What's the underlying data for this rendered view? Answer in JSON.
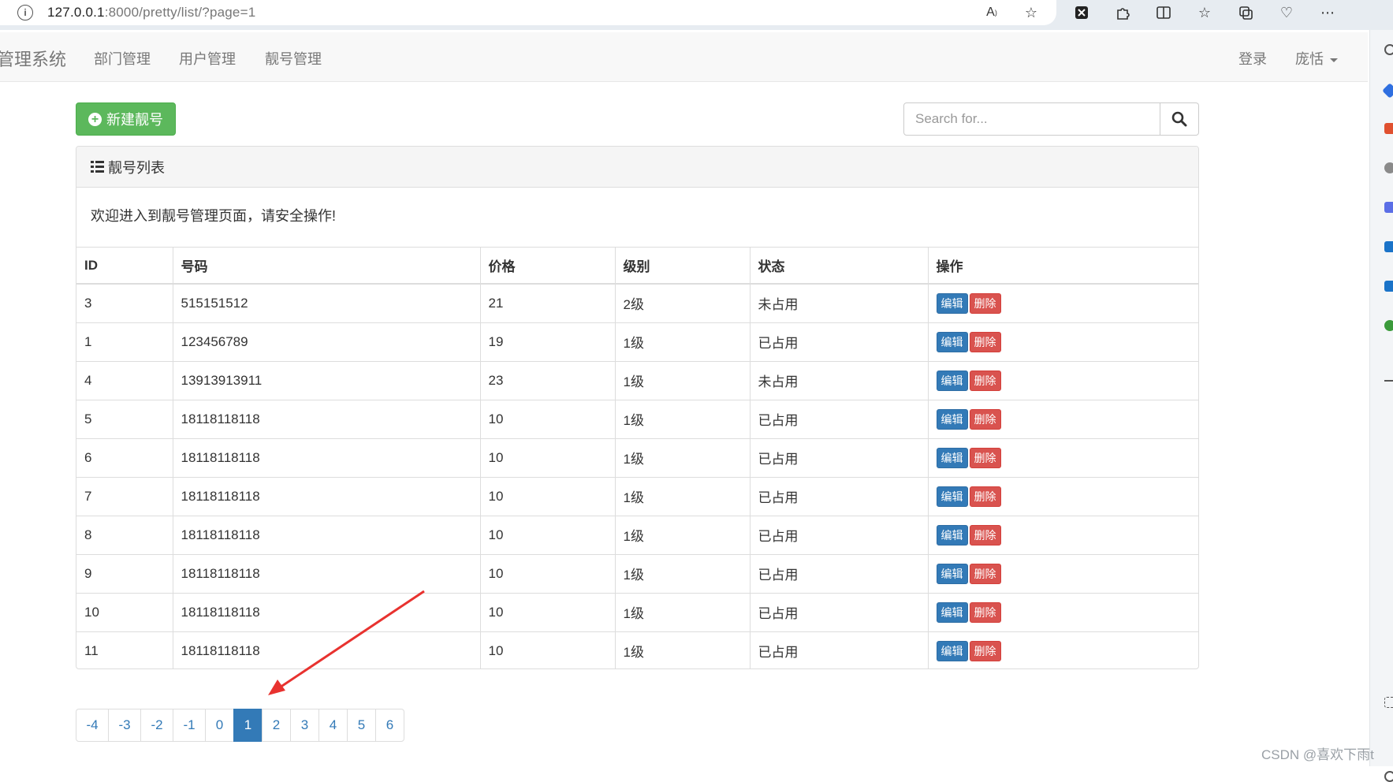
{
  "browser": {
    "url_host": "127.0.0.1",
    "url_rest": ":8000/pretty/list/?page=1"
  },
  "navbar": {
    "brand": "管理系统",
    "links": [
      "部门管理",
      "用户管理",
      "靓号管理"
    ],
    "login": "登录",
    "user": "庞恬"
  },
  "toolbar": {
    "new_button": "新建靓号",
    "search_placeholder": "Search for..."
  },
  "panel": {
    "title": "靓号列表",
    "welcome": "欢迎进入到靓号管理页面，请安全操作!"
  },
  "table": {
    "columns": [
      "ID",
      "号码",
      "价格",
      "级别",
      "状态",
      "操作"
    ],
    "edit_label": "编辑",
    "delete_label": "删除",
    "rows": [
      [
        "3",
        "515151512",
        "21",
        "2级",
        "未占用"
      ],
      [
        "1",
        "123456789",
        "19",
        "1级",
        "已占用"
      ],
      [
        "4",
        "13913913911",
        "23",
        "1级",
        "未占用"
      ],
      [
        "5",
        "18118118118",
        "10",
        "1级",
        "已占用"
      ],
      [
        "6",
        "18118118118",
        "10",
        "1级",
        "已占用"
      ],
      [
        "7",
        "18118118118",
        "10",
        "1级",
        "已占用"
      ],
      [
        "8",
        "18118118118",
        "10",
        "1级",
        "已占用"
      ],
      [
        "9",
        "18118118118",
        "10",
        "1级",
        "已占用"
      ],
      [
        "10",
        "18118118118",
        "10",
        "1级",
        "已占用"
      ],
      [
        "11",
        "18118118118",
        "10",
        "1级",
        "已占用"
      ]
    ]
  },
  "pagination": {
    "pages": [
      "-4",
      "-3",
      "-2",
      "-1",
      "0",
      "1",
      "2",
      "3",
      "4",
      "5",
      "6"
    ],
    "current": "1"
  },
  "colors": {
    "success": "#5cb85c",
    "primary": "#337ab7",
    "danger": "#d9534f",
    "annotation_arrow": "#e8322f"
  },
  "watermark": "CSDN @喜欢下雨t"
}
